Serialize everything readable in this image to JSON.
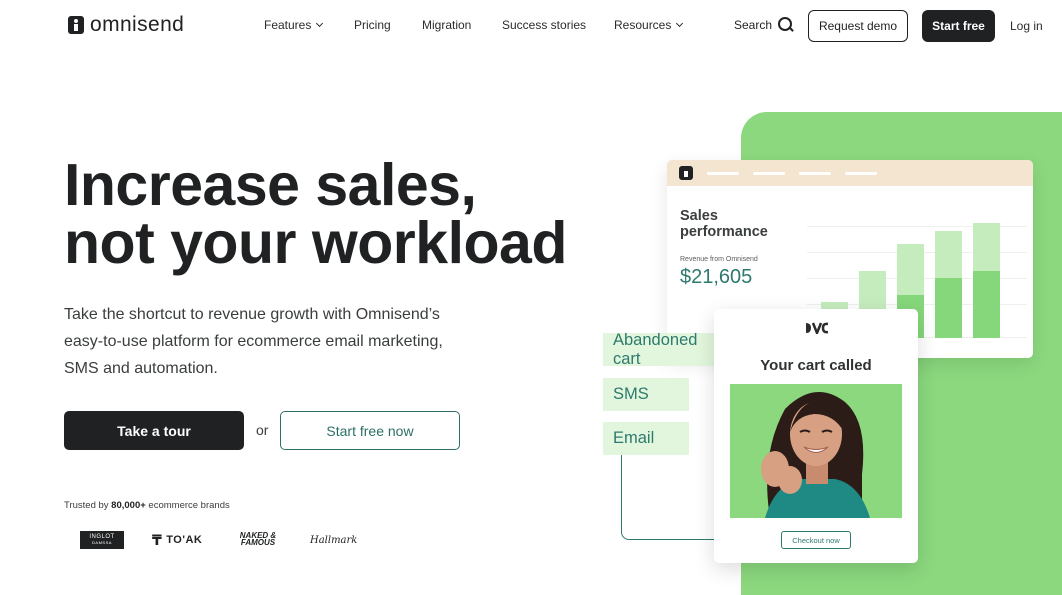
{
  "brand": {
    "name": "omnisend"
  },
  "nav": {
    "items": [
      {
        "label": "Features",
        "dropdown": true
      },
      {
        "label": "Pricing",
        "dropdown": false
      },
      {
        "label": "Migration",
        "dropdown": false
      },
      {
        "label": "Success stories",
        "dropdown": false
      },
      {
        "label": "Resources",
        "dropdown": true
      }
    ],
    "search_label": "Search",
    "request_demo": "Request demo",
    "start_free": "Start free",
    "login": "Log in"
  },
  "hero": {
    "title_line1": "Increase sales,",
    "title_line2": "not your workload",
    "subtitle": "Take the shortcut to revenue growth with Omnisend’s easy-to-use platform for ecommerce email marketing, SMS and automation.",
    "tour_button": "Take a tour",
    "or": "or",
    "free_button": "Start free now",
    "trusted_prefix": "Trusted by ",
    "trusted_count": "80,000+",
    "trusted_suffix": " ecommerce brands",
    "brands": {
      "inglot_1": "INGLOT",
      "inglot_2": "DAMSSA",
      "toak": "TO'AK",
      "naked_1": "NAKED &",
      "naked_2": "FAMOUS",
      "hallmark": "Hallmark"
    }
  },
  "illustration": {
    "sales_title_1": "Sales",
    "sales_title_2": "performance",
    "revenue_label": "Revenue from Omnisend",
    "revenue_value": "$21,605",
    "bars": [
      {
        "total": 0.27,
        "omnisend": 0.12
      },
      {
        "total": 0.5,
        "omnisend": 0.22
      },
      {
        "total": 0.7,
        "omnisend": 0.32
      },
      {
        "total": 0.8,
        "omnisend": 0.45
      },
      {
        "total": 0.86,
        "omnisend": 0.5
      }
    ],
    "channels": [
      "Abandoned cart",
      "SMS",
      "Email"
    ],
    "cart_brand": "DVC",
    "cart_title": "Your cart called",
    "checkout_button": "Checkout now",
    "colors": {
      "accent_green": "#8bd87e",
      "teal": "#2d7a6e",
      "dark": "#1f2122"
    }
  }
}
